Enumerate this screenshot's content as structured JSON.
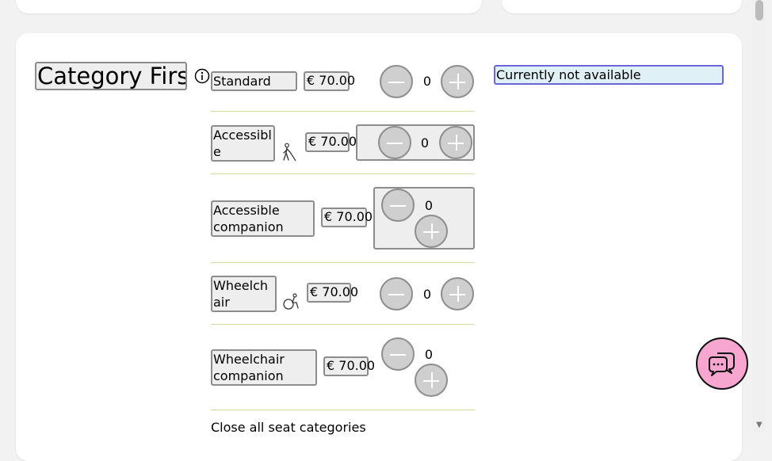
{
  "category": {
    "title": "Category First",
    "info_icon": "info-circle-icon",
    "availability": "Currently not available"
  },
  "seats": [
    {
      "label": "Standard",
      "price": "€ 70.00",
      "quantity": "0",
      "icon": ""
    },
    {
      "label": "Accessible",
      "price": "€ 70.00",
      "quantity": "0",
      "icon": "blind-person-with-cane-icon"
    },
    {
      "label": "Accessible companion",
      "price": "€ 70.00",
      "quantity": "0",
      "icon": ""
    },
    {
      "label": "Wheelchair",
      "price": "€ 70.00",
      "quantity": "0",
      "icon": "wheelchair-icon"
    },
    {
      "label": "Wheelchair companion",
      "price": "€ 70.00",
      "quantity": "0",
      "icon": ""
    }
  ],
  "close_link": "Close all seat categories",
  "chat": {
    "icon": "chat-bubbles-icon",
    "color": "#f7a6cf"
  },
  "colors": {
    "divider": "#d8d6a0",
    "focus_border": "#6a66d9",
    "availability_bg": "#dff0f6"
  }
}
